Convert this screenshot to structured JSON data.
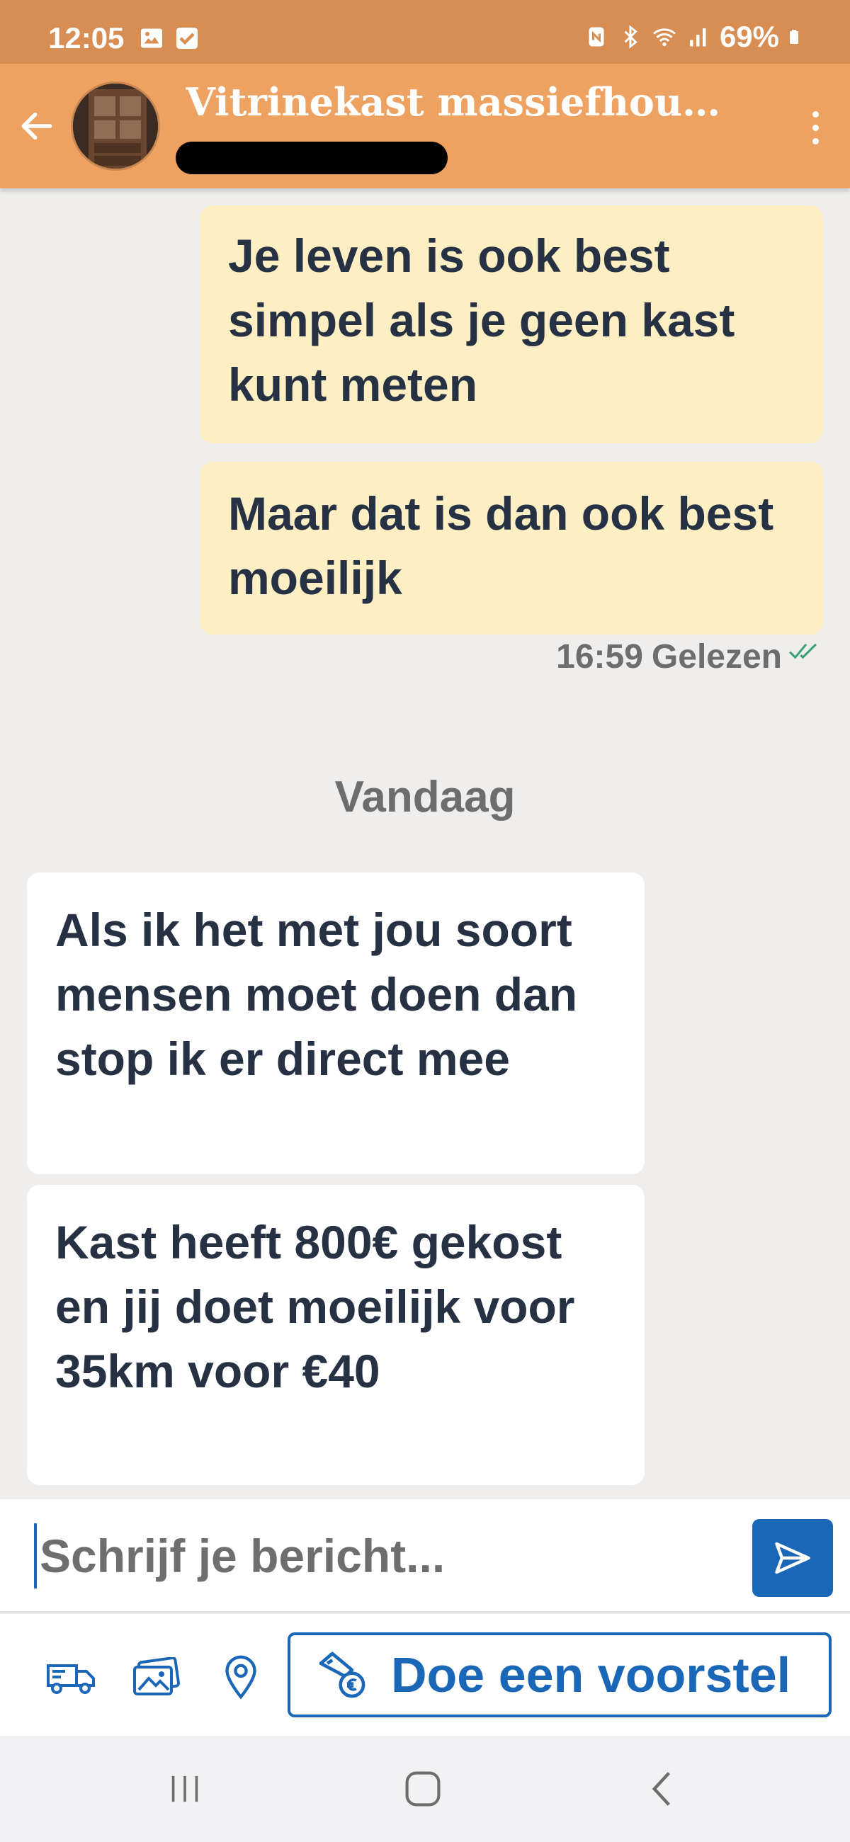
{
  "status_bar": {
    "time": "12:05",
    "battery": "69%",
    "icons": [
      "gallery-icon",
      "checkbox-icon",
      "nfc-icon",
      "bluetooth-icon",
      "wifi-icon",
      "signal-icon",
      "battery-icon"
    ]
  },
  "header": {
    "title": "Vitrinekast massiefhout -...",
    "back_icon": "arrow-left-icon",
    "menu_icon": "more-vertical-icon"
  },
  "messages": [
    {
      "direction": "outgoing",
      "text": "Je leven is ook best simpel als je geen kast kunt meten"
    },
    {
      "direction": "outgoing",
      "text": "Maar dat is dan ook best moeilijk"
    },
    {
      "direction": "incoming",
      "text": "Als ik het met jou soort mensen moet doen dan stop ik er direct mee"
    },
    {
      "direction": "incoming",
      "text": "Kast heeft 800€ gekost en jij doet moeilijk voor 35km voor €40"
    }
  ],
  "read_receipt": {
    "time": "16:59",
    "status": "Gelezen"
  },
  "date_separator": "Vandaag",
  "composer": {
    "placeholder": "Schrijf je bericht...",
    "send_icon": "send-icon"
  },
  "actions": {
    "icons": [
      "truck-icon",
      "photos-icon",
      "location-pin-icon"
    ],
    "offer_label": "Doe een voorstel",
    "offer_icon": "hand-coin-icon"
  },
  "nav": [
    "recents-icon",
    "home-icon",
    "back-icon"
  ],
  "colors": {
    "status_bar": "#d88d52",
    "header": "#eea262",
    "outgoing_bubble": "#fdeec4",
    "incoming_bubble": "#ffffff",
    "accent_blue": "#1a67b8",
    "read_check": "#3aa17a"
  }
}
